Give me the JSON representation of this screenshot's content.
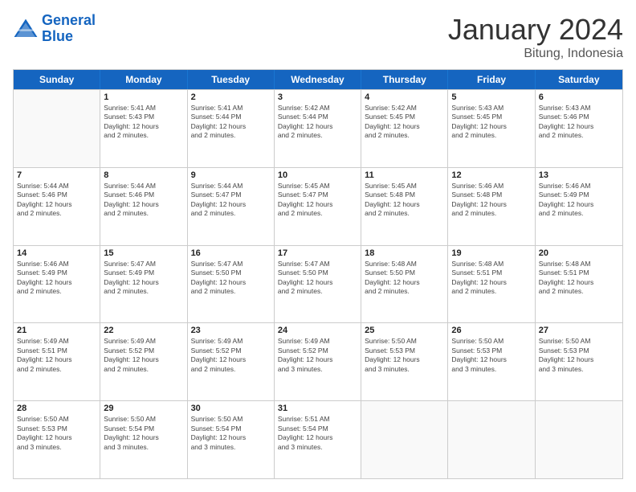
{
  "logo": {
    "line1": "General",
    "line2": "Blue"
  },
  "header": {
    "month": "January 2024",
    "location": "Bitung, Indonesia"
  },
  "weekdays": [
    "Sunday",
    "Monday",
    "Tuesday",
    "Wednesday",
    "Thursday",
    "Friday",
    "Saturday"
  ],
  "rows": [
    [
      {
        "day": "",
        "lines": []
      },
      {
        "day": "1",
        "lines": [
          "Sunrise: 5:41 AM",
          "Sunset: 5:43 PM",
          "Daylight: 12 hours",
          "and 2 minutes."
        ]
      },
      {
        "day": "2",
        "lines": [
          "Sunrise: 5:41 AM",
          "Sunset: 5:44 PM",
          "Daylight: 12 hours",
          "and 2 minutes."
        ]
      },
      {
        "day": "3",
        "lines": [
          "Sunrise: 5:42 AM",
          "Sunset: 5:44 PM",
          "Daylight: 12 hours",
          "and 2 minutes."
        ]
      },
      {
        "day": "4",
        "lines": [
          "Sunrise: 5:42 AM",
          "Sunset: 5:45 PM",
          "Daylight: 12 hours",
          "and 2 minutes."
        ]
      },
      {
        "day": "5",
        "lines": [
          "Sunrise: 5:43 AM",
          "Sunset: 5:45 PM",
          "Daylight: 12 hours",
          "and 2 minutes."
        ]
      },
      {
        "day": "6",
        "lines": [
          "Sunrise: 5:43 AM",
          "Sunset: 5:46 PM",
          "Daylight: 12 hours",
          "and 2 minutes."
        ]
      }
    ],
    [
      {
        "day": "7",
        "lines": [
          "Sunrise: 5:44 AM",
          "Sunset: 5:46 PM",
          "Daylight: 12 hours",
          "and 2 minutes."
        ]
      },
      {
        "day": "8",
        "lines": [
          "Sunrise: 5:44 AM",
          "Sunset: 5:46 PM",
          "Daylight: 12 hours",
          "and 2 minutes."
        ]
      },
      {
        "day": "9",
        "lines": [
          "Sunrise: 5:44 AM",
          "Sunset: 5:47 PM",
          "Daylight: 12 hours",
          "and 2 minutes."
        ]
      },
      {
        "day": "10",
        "lines": [
          "Sunrise: 5:45 AM",
          "Sunset: 5:47 PM",
          "Daylight: 12 hours",
          "and 2 minutes."
        ]
      },
      {
        "day": "11",
        "lines": [
          "Sunrise: 5:45 AM",
          "Sunset: 5:48 PM",
          "Daylight: 12 hours",
          "and 2 minutes."
        ]
      },
      {
        "day": "12",
        "lines": [
          "Sunrise: 5:46 AM",
          "Sunset: 5:48 PM",
          "Daylight: 12 hours",
          "and 2 minutes."
        ]
      },
      {
        "day": "13",
        "lines": [
          "Sunrise: 5:46 AM",
          "Sunset: 5:49 PM",
          "Daylight: 12 hours",
          "and 2 minutes."
        ]
      }
    ],
    [
      {
        "day": "14",
        "lines": [
          "Sunrise: 5:46 AM",
          "Sunset: 5:49 PM",
          "Daylight: 12 hours",
          "and 2 minutes."
        ]
      },
      {
        "day": "15",
        "lines": [
          "Sunrise: 5:47 AM",
          "Sunset: 5:49 PM",
          "Daylight: 12 hours",
          "and 2 minutes."
        ]
      },
      {
        "day": "16",
        "lines": [
          "Sunrise: 5:47 AM",
          "Sunset: 5:50 PM",
          "Daylight: 12 hours",
          "and 2 minutes."
        ]
      },
      {
        "day": "17",
        "lines": [
          "Sunrise: 5:47 AM",
          "Sunset: 5:50 PM",
          "Daylight: 12 hours",
          "and 2 minutes."
        ]
      },
      {
        "day": "18",
        "lines": [
          "Sunrise: 5:48 AM",
          "Sunset: 5:50 PM",
          "Daylight: 12 hours",
          "and 2 minutes."
        ]
      },
      {
        "day": "19",
        "lines": [
          "Sunrise: 5:48 AM",
          "Sunset: 5:51 PM",
          "Daylight: 12 hours",
          "and 2 minutes."
        ]
      },
      {
        "day": "20",
        "lines": [
          "Sunrise: 5:48 AM",
          "Sunset: 5:51 PM",
          "Daylight: 12 hours",
          "and 2 minutes."
        ]
      }
    ],
    [
      {
        "day": "21",
        "lines": [
          "Sunrise: 5:49 AM",
          "Sunset: 5:51 PM",
          "Daylight: 12 hours",
          "and 2 minutes."
        ]
      },
      {
        "day": "22",
        "lines": [
          "Sunrise: 5:49 AM",
          "Sunset: 5:52 PM",
          "Daylight: 12 hours",
          "and 2 minutes."
        ]
      },
      {
        "day": "23",
        "lines": [
          "Sunrise: 5:49 AM",
          "Sunset: 5:52 PM",
          "Daylight: 12 hours",
          "and 2 minutes."
        ]
      },
      {
        "day": "24",
        "lines": [
          "Sunrise: 5:49 AM",
          "Sunset: 5:52 PM",
          "Daylight: 12 hours",
          "and 3 minutes."
        ]
      },
      {
        "day": "25",
        "lines": [
          "Sunrise: 5:50 AM",
          "Sunset: 5:53 PM",
          "Daylight: 12 hours",
          "and 3 minutes."
        ]
      },
      {
        "day": "26",
        "lines": [
          "Sunrise: 5:50 AM",
          "Sunset: 5:53 PM",
          "Daylight: 12 hours",
          "and 3 minutes."
        ]
      },
      {
        "day": "27",
        "lines": [
          "Sunrise: 5:50 AM",
          "Sunset: 5:53 PM",
          "Daylight: 12 hours",
          "and 3 minutes."
        ]
      }
    ],
    [
      {
        "day": "28",
        "lines": [
          "Sunrise: 5:50 AM",
          "Sunset: 5:53 PM",
          "Daylight: 12 hours",
          "and 3 minutes."
        ]
      },
      {
        "day": "29",
        "lines": [
          "Sunrise: 5:50 AM",
          "Sunset: 5:54 PM",
          "Daylight: 12 hours",
          "and 3 minutes."
        ]
      },
      {
        "day": "30",
        "lines": [
          "Sunrise: 5:50 AM",
          "Sunset: 5:54 PM",
          "Daylight: 12 hours",
          "and 3 minutes."
        ]
      },
      {
        "day": "31",
        "lines": [
          "Sunrise: 5:51 AM",
          "Sunset: 5:54 PM",
          "Daylight: 12 hours",
          "and 3 minutes."
        ]
      },
      {
        "day": "",
        "lines": []
      },
      {
        "day": "",
        "lines": []
      },
      {
        "day": "",
        "lines": []
      }
    ]
  ]
}
